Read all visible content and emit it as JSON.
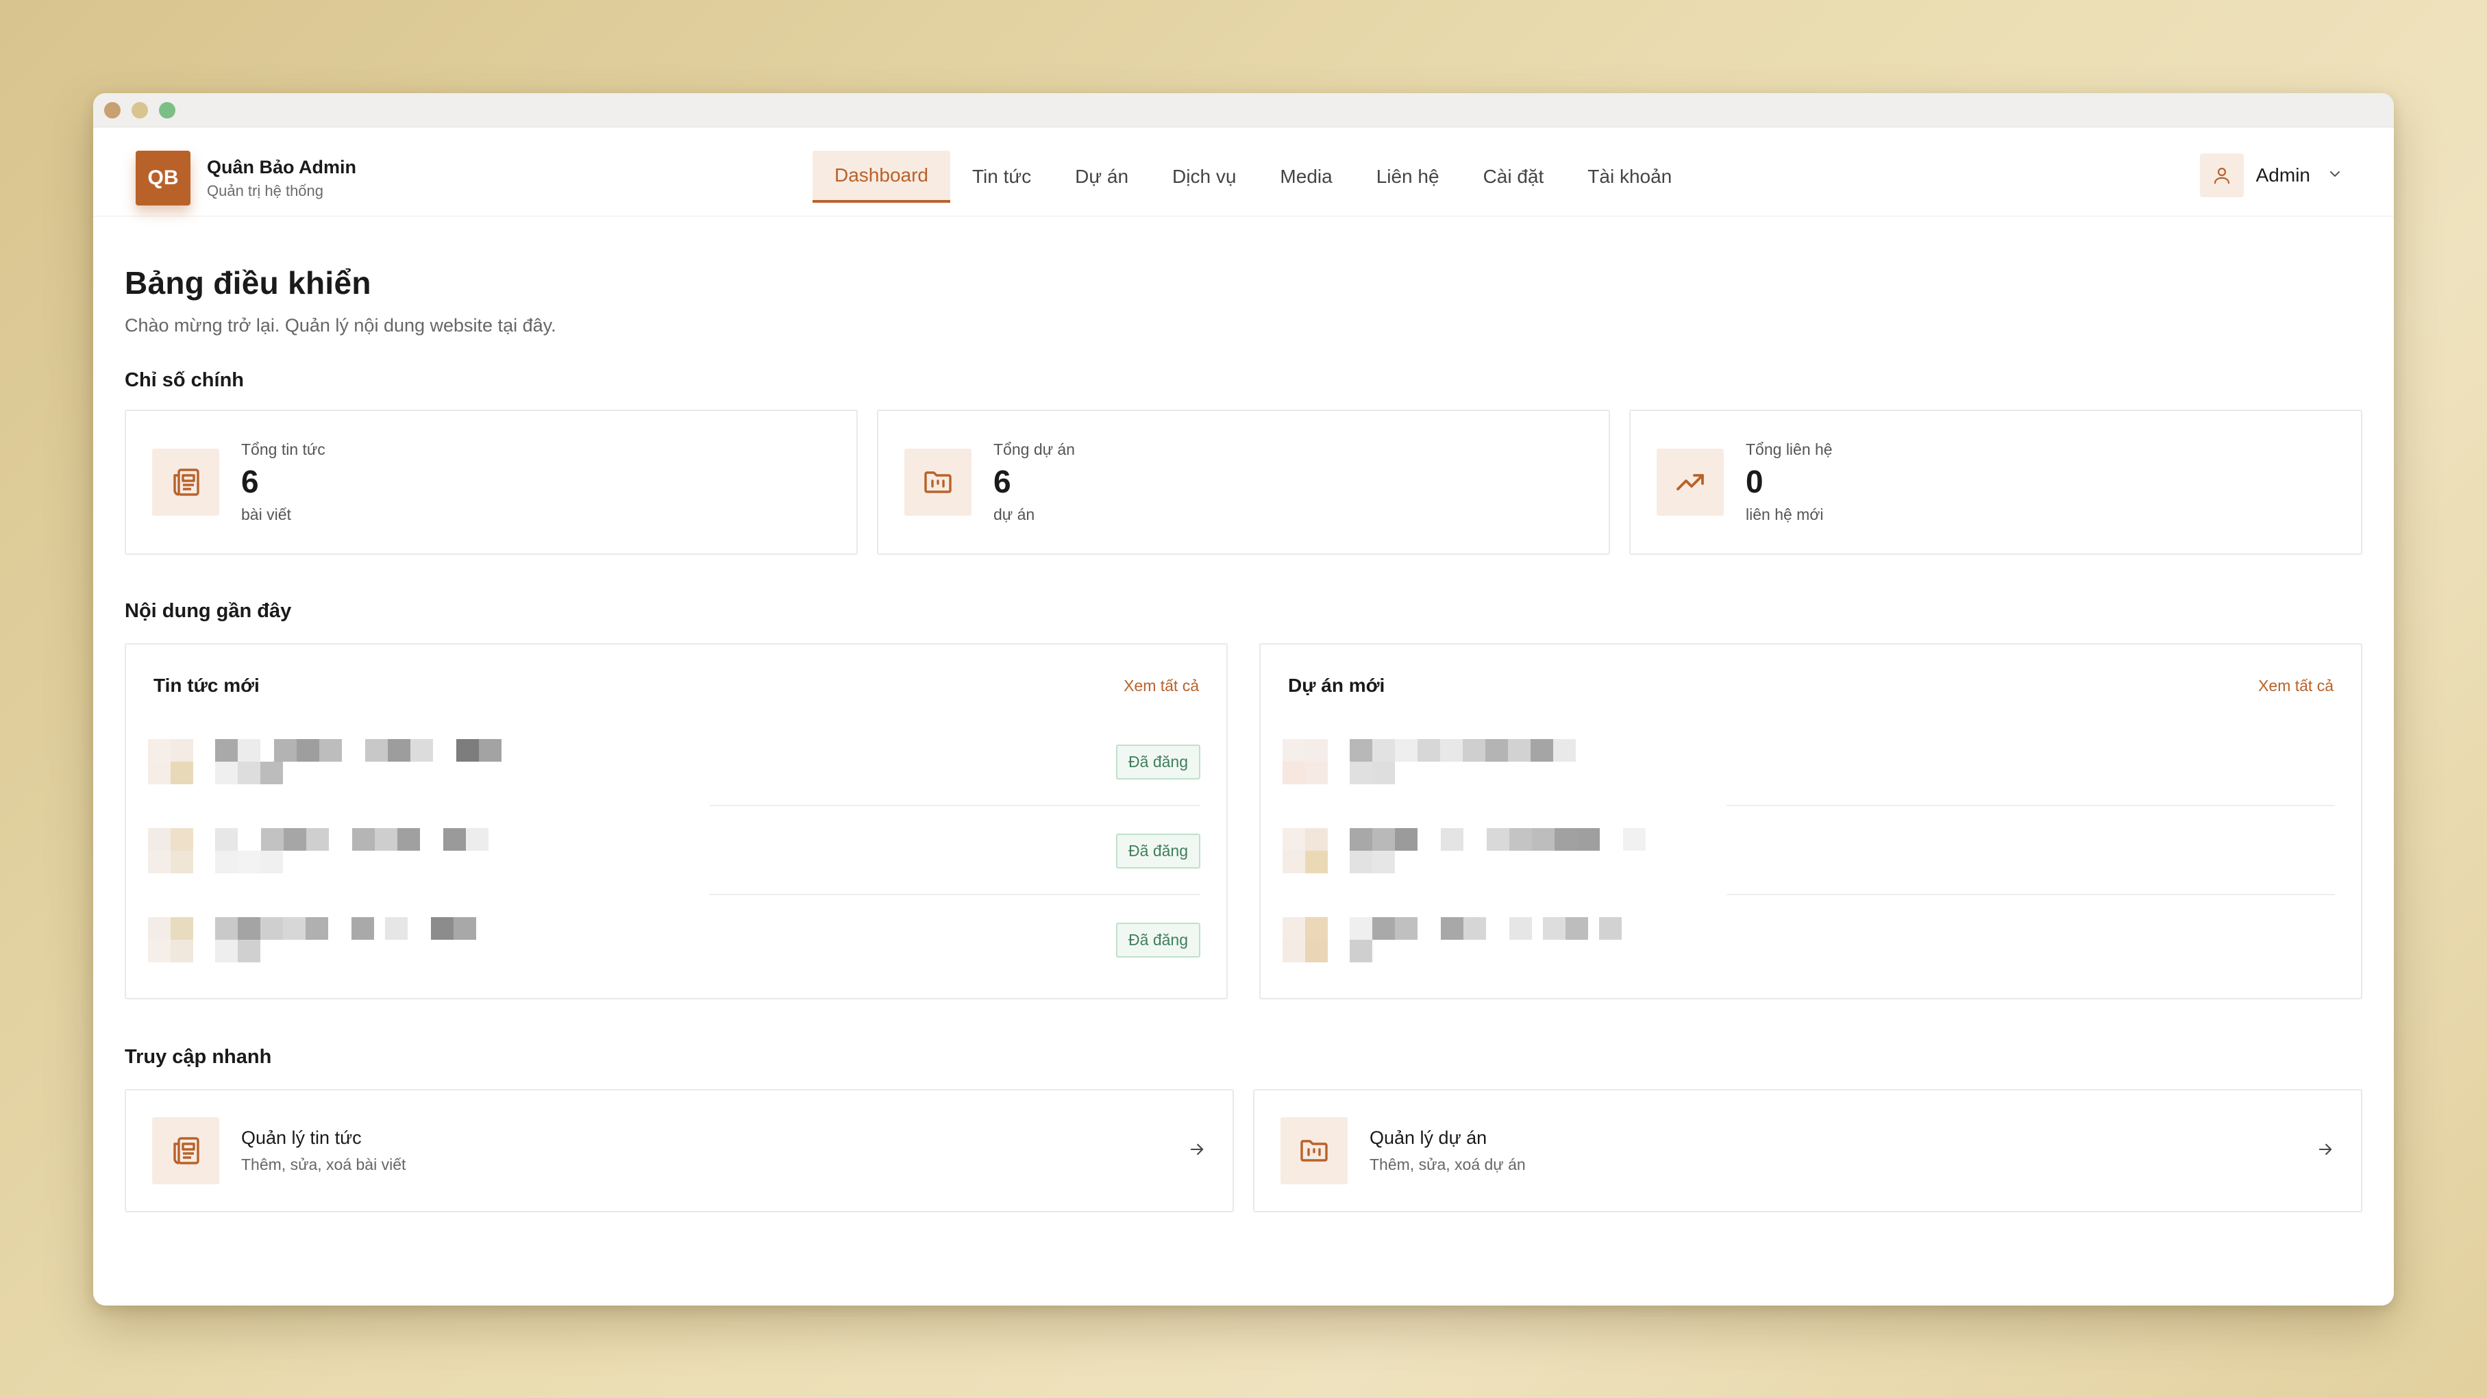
{
  "brand": {
    "initials": "QB",
    "name": "Quân Bảo Admin",
    "subtitle": "Quản trị hệ thống"
  },
  "nav": [
    {
      "label": "Dashboard",
      "active": true
    },
    {
      "label": "Tin tức"
    },
    {
      "label": "Dự án"
    },
    {
      "label": "Dịch vụ"
    },
    {
      "label": "Media"
    },
    {
      "label": "Liên hệ"
    },
    {
      "label": "Cài đặt"
    },
    {
      "label": "Tài khoản"
    }
  ],
  "user": {
    "name": "Admin",
    "icon": "user-icon"
  },
  "page": {
    "title": "Bảng điều khiển",
    "subtitle": "Chào mừng trở lại. Quản lý nội dung website tại đây."
  },
  "stats": {
    "section_title": "Chỉ số chính",
    "items": [
      {
        "label": "Tổng tin tức",
        "value": "6",
        "unit": "bài viết",
        "icon": "news-icon"
      },
      {
        "label": "Tổng dự án",
        "value": "6",
        "unit": "dự án",
        "icon": "folder-icon"
      },
      {
        "label": "Tổng liên hệ",
        "value": "0",
        "unit": "liên hệ mới",
        "icon": "trending-up-icon"
      }
    ]
  },
  "recent": {
    "section_title": "Nội dung gần đây",
    "news": {
      "title": "Tin tức mới",
      "link": "Xem tất cả",
      "rows": [
        {
          "status": "Đã đăng"
        },
        {
          "status": "Đã đăng"
        },
        {
          "status": "Đã đăng"
        }
      ]
    },
    "projects": {
      "title": "Dự án mới",
      "link": "Xem tất cả"
    }
  },
  "quick": {
    "section_title": "Truy cập nhanh",
    "items": [
      {
        "title": "Quản lý tin tức",
        "subtitle": "Thêm, sửa, xoá bài viết",
        "icon": "news-icon"
      },
      {
        "title": "Quản lý dự án",
        "subtitle": "Thêm, sửa, xoá dự án",
        "icon": "folder-icon"
      }
    ]
  },
  "colors": {
    "accent": "#b8622a",
    "accent_bg": "#f8ebe2",
    "success": "#3f7f5a"
  }
}
